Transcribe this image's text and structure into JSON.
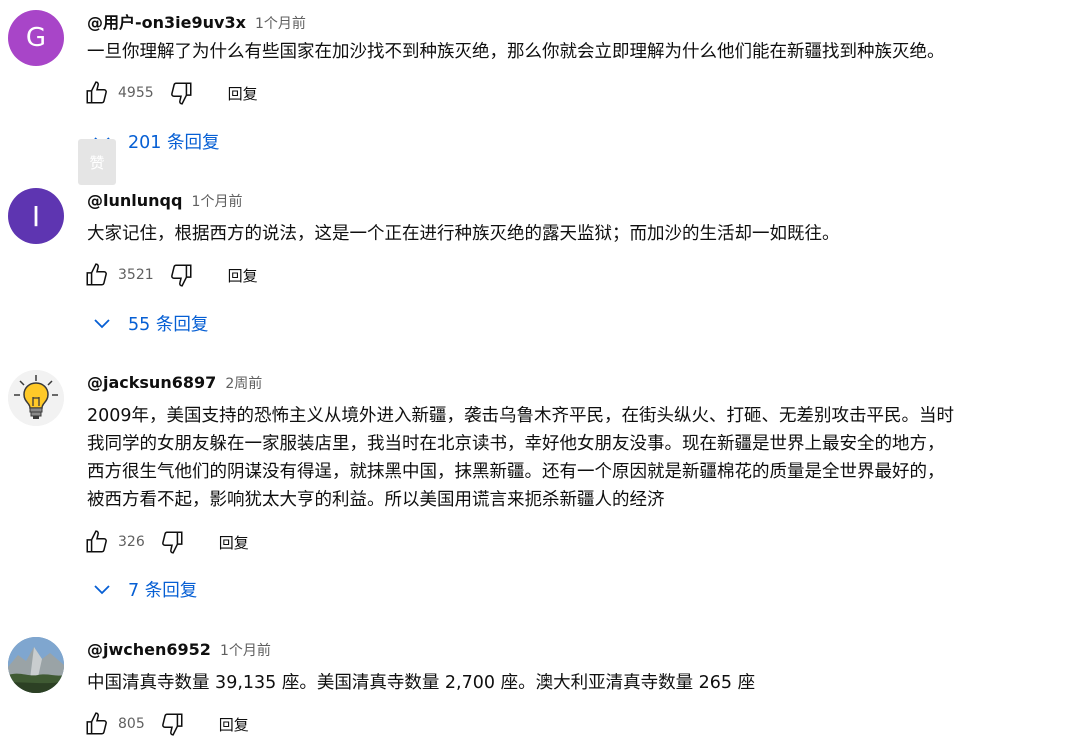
{
  "comments": [
    {
      "avatar_letter": "G",
      "avatar_color": "#a845c8",
      "author": "@用户-on3ie9uv3x",
      "time": "1个月前",
      "text": "一旦你理解了为什么有些国家在加沙找不到种族灭绝，那么你就会立即理解为什么他们能在新疆找到种族灭绝。",
      "likes": "4955",
      "reply_label": "回复",
      "replies_label": "201 条回复"
    },
    {
      "avatar_letter": "I",
      "avatar_color": "#5e35b1",
      "author": "@lunlunqq",
      "time": "1个月前",
      "text": "大家记住，根据西方的说法，这是一个正在进行种族灭绝的露天监狱；而加沙的生活却一如既往。",
      "likes": "3521",
      "reply_label": "回复",
      "replies_label": "55 条回复"
    },
    {
      "avatar_letter": "",
      "avatar_color": "#f2f2f2",
      "author": "@jacksun6897",
      "time": "2周前",
      "text_lines": [
        "2009年，美国支持的恐怖主义从境外进入新疆，袭击乌鲁木齐平民，在街头纵火、打砸、无差别攻击平民。当时",
        "我同学的女朋友躲在一家服装店里，我当时在北京读书，幸好他女朋友没事。现在新疆是世界上最安全的地方，",
        "西方很生气他们的阴谋没有得逞，就抹黑中国，抹黑新疆。还有一个原因就是新疆棉花的质量是全世界最好的，",
        "被西方看不起，影响犹太大亨的利益。所以美国用谎言来扼杀新疆人的经济"
      ],
      "likes": "326",
      "reply_label": "回复",
      "replies_label": "7 条回复"
    },
    {
      "avatar_letter": "",
      "avatar_color": "#6b8fb5",
      "author": "@jwchen6952",
      "time": "1个月前",
      "text": "中国清真寺数量 39,135 座。美国清真寺数量 2,700 座。澳大利亚清真寺数量 265 座",
      "likes": "805",
      "reply_label": "回复"
    }
  ],
  "tooltip": "赞"
}
